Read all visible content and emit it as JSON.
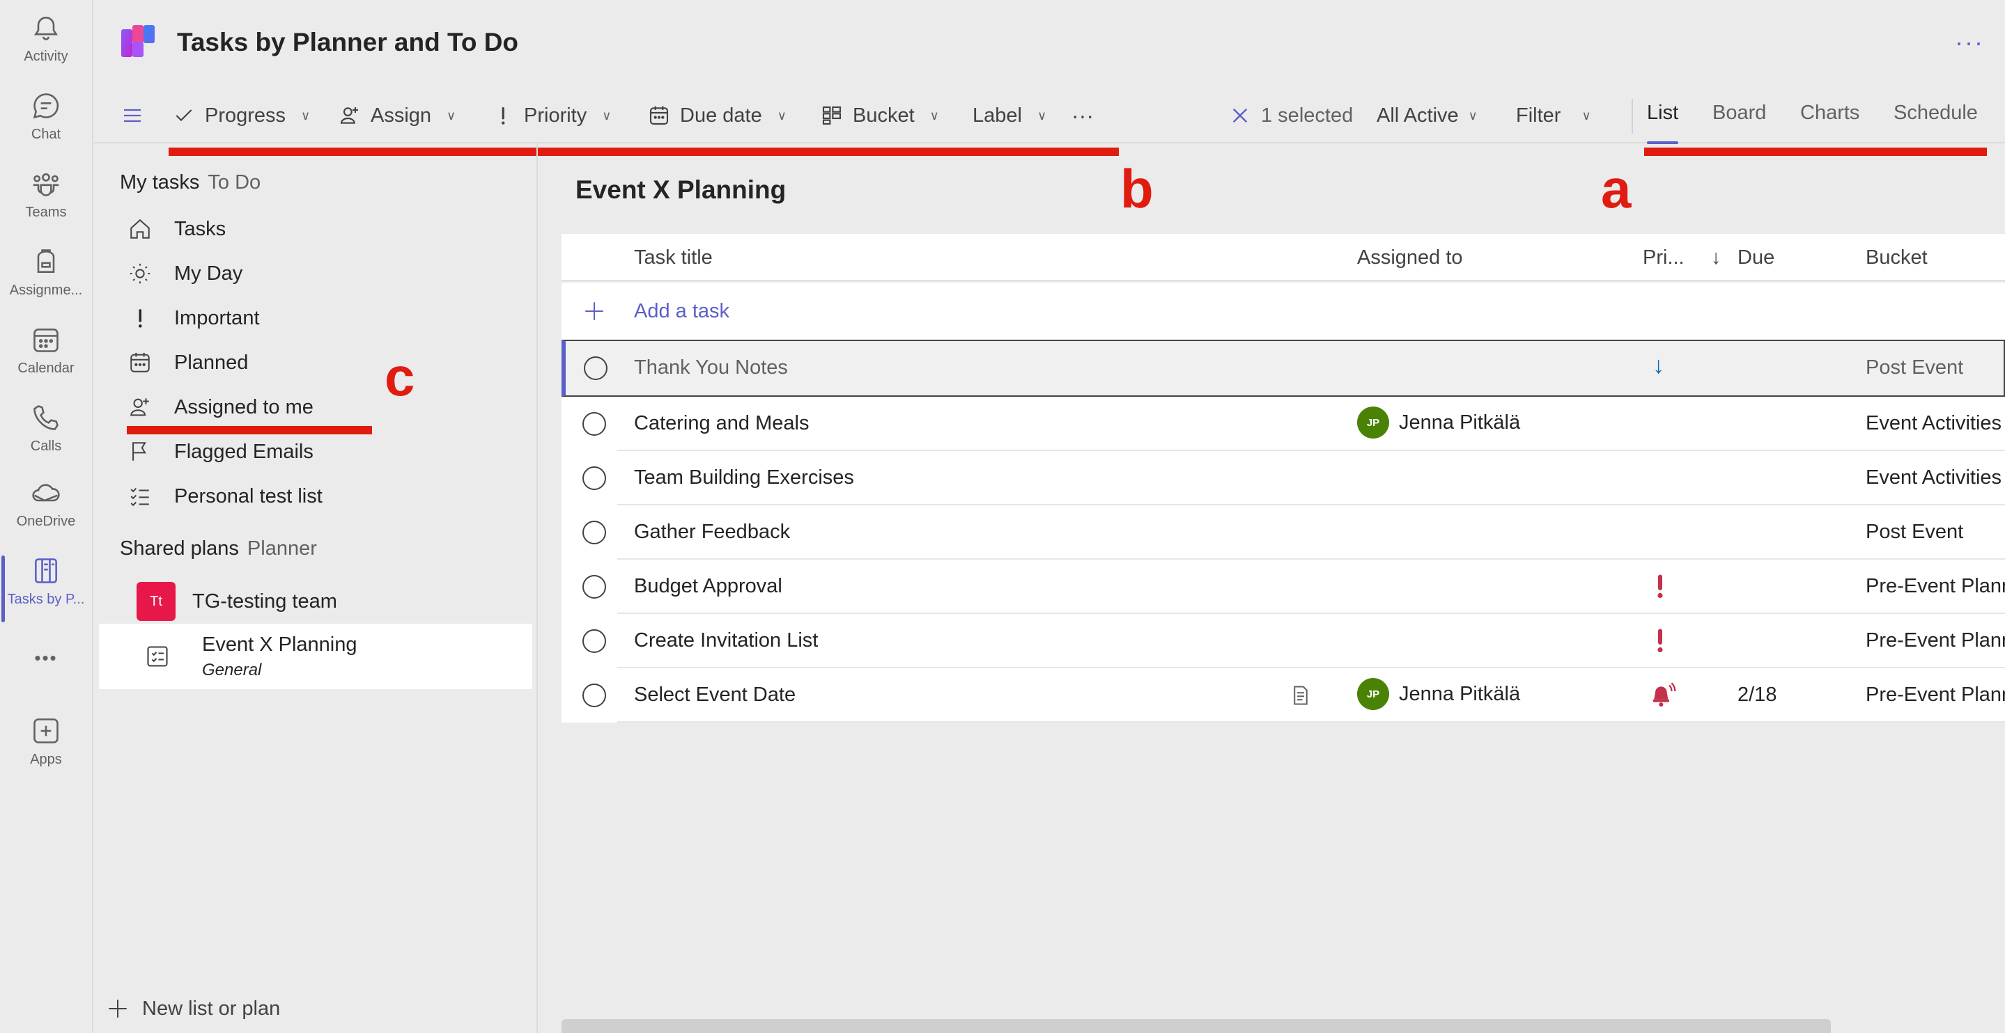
{
  "rail": {
    "items": [
      {
        "label": "Activity",
        "icon": "bell-icon"
      },
      {
        "label": "Chat",
        "icon": "chat-icon"
      },
      {
        "label": "Teams",
        "icon": "teams-icon"
      },
      {
        "label": "Assignme...",
        "icon": "assignments-icon"
      },
      {
        "label": "Calendar",
        "icon": "calendar-icon"
      },
      {
        "label": "Calls",
        "icon": "phone-icon"
      },
      {
        "label": "OneDrive",
        "icon": "cloud-icon"
      },
      {
        "label": "Tasks by P...",
        "icon": "tasks-icon"
      },
      {
        "label": "Apps",
        "icon": "add-app-icon"
      }
    ],
    "more_label": "•••"
  },
  "header": {
    "title": "Tasks by Planner and To Do",
    "more_label": "···"
  },
  "toolbar": {
    "progress_label": "Progress",
    "assign_label": "Assign",
    "priority_label": "Priority",
    "due_date_label": "Due date",
    "bucket_label": "Bucket",
    "label_label": "Label",
    "more_label": "···",
    "selected_label": "1 selected",
    "filter_active_label": "All Active",
    "filter_label": "Filter",
    "tabs": [
      "List",
      "Board",
      "Charts",
      "Schedule"
    ]
  },
  "annotations": {
    "a": "a",
    "b": "b",
    "c": "c"
  },
  "sidebar": {
    "my_tasks": "My tasks",
    "my_tasks_sub": "To Do",
    "items": [
      {
        "label": "Tasks",
        "icon": "home-icon"
      },
      {
        "label": "My Day",
        "icon": "sun-icon"
      },
      {
        "label": "Important",
        "icon": "exclamation-icon"
      },
      {
        "label": "Planned",
        "icon": "calendar-icon"
      },
      {
        "label": "Assigned to me",
        "icon": "person-add-icon"
      },
      {
        "label": "Flagged Emails",
        "icon": "flag-icon"
      },
      {
        "label": "Personal test list",
        "icon": "checklist-icon"
      }
    ],
    "shared_plans": "Shared plans",
    "shared_plans_sub": "Planner",
    "plans": [
      {
        "label": "TG-testing team",
        "avatar": "Tt"
      },
      {
        "label": "Event X Planning",
        "sub": "General"
      }
    ],
    "new_list_label": "New list or plan"
  },
  "main": {
    "plan_title": "Event X Planning",
    "columns": {
      "title": "Task title",
      "assigned": "Assigned to",
      "priority": "Pri...",
      "due": "Due",
      "bucket": "Bucket"
    },
    "add_task_label": "Add a task",
    "tasks": [
      {
        "title": "Thank You Notes",
        "assigned": "",
        "priority": "low",
        "due": "",
        "bucket": "Post Event"
      },
      {
        "title": "Catering and Meals",
        "assigned": "Jenna Pitkälä",
        "initials": "JP",
        "priority": "",
        "due": "",
        "bucket": "Event Activities"
      },
      {
        "title": "Team Building Exercises",
        "assigned": "",
        "priority": "",
        "due": "",
        "bucket": "Event Activities"
      },
      {
        "title": "Gather Feedback",
        "assigned": "",
        "priority": "",
        "due": "",
        "bucket": "Post Event"
      },
      {
        "title": "Budget Approval",
        "assigned": "",
        "priority": "important",
        "due": "",
        "bucket": "Pre-Event Planning"
      },
      {
        "title": "Create Invitation List",
        "assigned": "",
        "priority": "important",
        "due": "",
        "bucket": "Pre-Event Planning"
      },
      {
        "title": "Select Event Date",
        "assigned": "Jenna Pitkälä",
        "initials": "JP",
        "priority": "urgent",
        "due": "2/18",
        "bucket": "Pre-Event Planning"
      }
    ]
  },
  "colors": {
    "accent": "#5b5fc7",
    "annotation": "#e01b0f",
    "important": "#c4314b",
    "avatar": "#498205"
  }
}
